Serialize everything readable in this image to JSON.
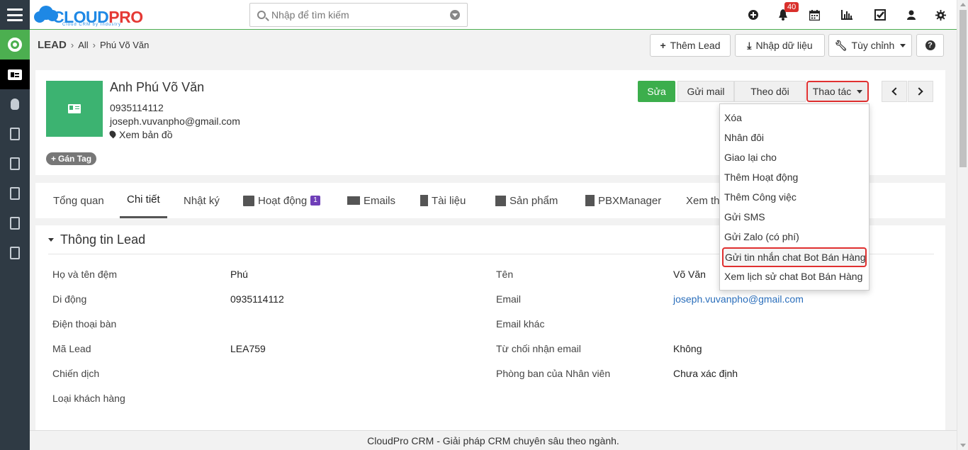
{
  "topbar": {
    "logo_main": "CLOUD",
    "logo_accent": "PRO",
    "logo_tagline": "Cloud CRM by Industry",
    "search_placeholder": "Nhập để tìm kiếm",
    "notification_count": "40",
    "icons": [
      "plus-circle-icon",
      "bell-icon",
      "calendar-icon",
      "bar-chart-icon",
      "checkbox-icon",
      "user-icon",
      "gear-icon"
    ]
  },
  "sidebar": {
    "items": [
      "menu-icon",
      "home-ring-icon",
      "lead-card-icon",
      "money-bag-icon",
      "contact-icon",
      "invoice-icon",
      "so-icon",
      "edit-note-icon",
      "document-icon"
    ]
  },
  "breadcrumb": {
    "module": "LEAD",
    "filter": "All",
    "record": "Phú Võ Văn"
  },
  "toolbar": {
    "add_lead": "Thêm Lead",
    "import": "Nhập dữ liệu",
    "customize": "Tùy chỉnh",
    "help": "?"
  },
  "record": {
    "name": "Anh Phú Võ Văn",
    "phone": "0935114112",
    "email": "joseph.vuvanpho@gmail.com",
    "map": "Xem bản đồ",
    "tag": "Gán Tag"
  },
  "actions": {
    "edit": "Sửa",
    "send_mail": "Gửi mail",
    "follow": "Theo dõi",
    "more": "Thao tác"
  },
  "dropdown": {
    "items": [
      "Xóa",
      "Nhân đôi",
      "Giao lại cho",
      "Thêm Hoạt động",
      "Thêm Công việc",
      "Gửi SMS",
      "Gửi Zalo (có phí)",
      "Gửi tin nhắn chat Bot Bán Hàng",
      "Xem lịch sử chat Bot Bán Hàng"
    ],
    "highlighted_index": 7
  },
  "tabs": [
    {
      "label": "Tổng quan"
    },
    {
      "label": "Chi tiết"
    },
    {
      "label": "Nhật ký"
    },
    {
      "label": "Hoạt động",
      "badge": "1"
    },
    {
      "label": "Emails"
    },
    {
      "label": "Tài liệu"
    },
    {
      "label": "Sản phẩm"
    },
    {
      "label": "PBXManager"
    },
    {
      "label": "Xem th"
    }
  ],
  "section": {
    "title": "Thông tin Lead",
    "left": [
      {
        "label": "Họ và tên đệm",
        "value": "Phú"
      },
      {
        "label": "Di động",
        "value": "0935114112"
      },
      {
        "label": "Điện thoại bàn",
        "value": ""
      },
      {
        "label": "Mã Lead",
        "value": "LEA759"
      },
      {
        "label": "Chiến dịch",
        "value": ""
      },
      {
        "label": "Loại khách hàng",
        "value": ""
      }
    ],
    "right": [
      {
        "label": "Tên",
        "value": "Võ Văn"
      },
      {
        "label": "Email",
        "value": "joseph.vuvanpho@gmail.com"
      },
      {
        "label": "Email khác",
        "value": ""
      },
      {
        "label": "Từ chối nhận email",
        "value": "Không"
      },
      {
        "label": "Phòng ban của Nhân viên",
        "value": "Chưa xác định"
      }
    ]
  },
  "footer": {
    "text": "CloudPro CRM - Giải pháp CRM chuyên sâu theo ngành."
  },
  "colors": {
    "primary_green": "#3cae4c",
    "sidebar_bg": "#2f3a44",
    "highlight_red": "#e03030",
    "brand_blue": "#1e88e5",
    "badge_purple": "#6f3fb8"
  }
}
